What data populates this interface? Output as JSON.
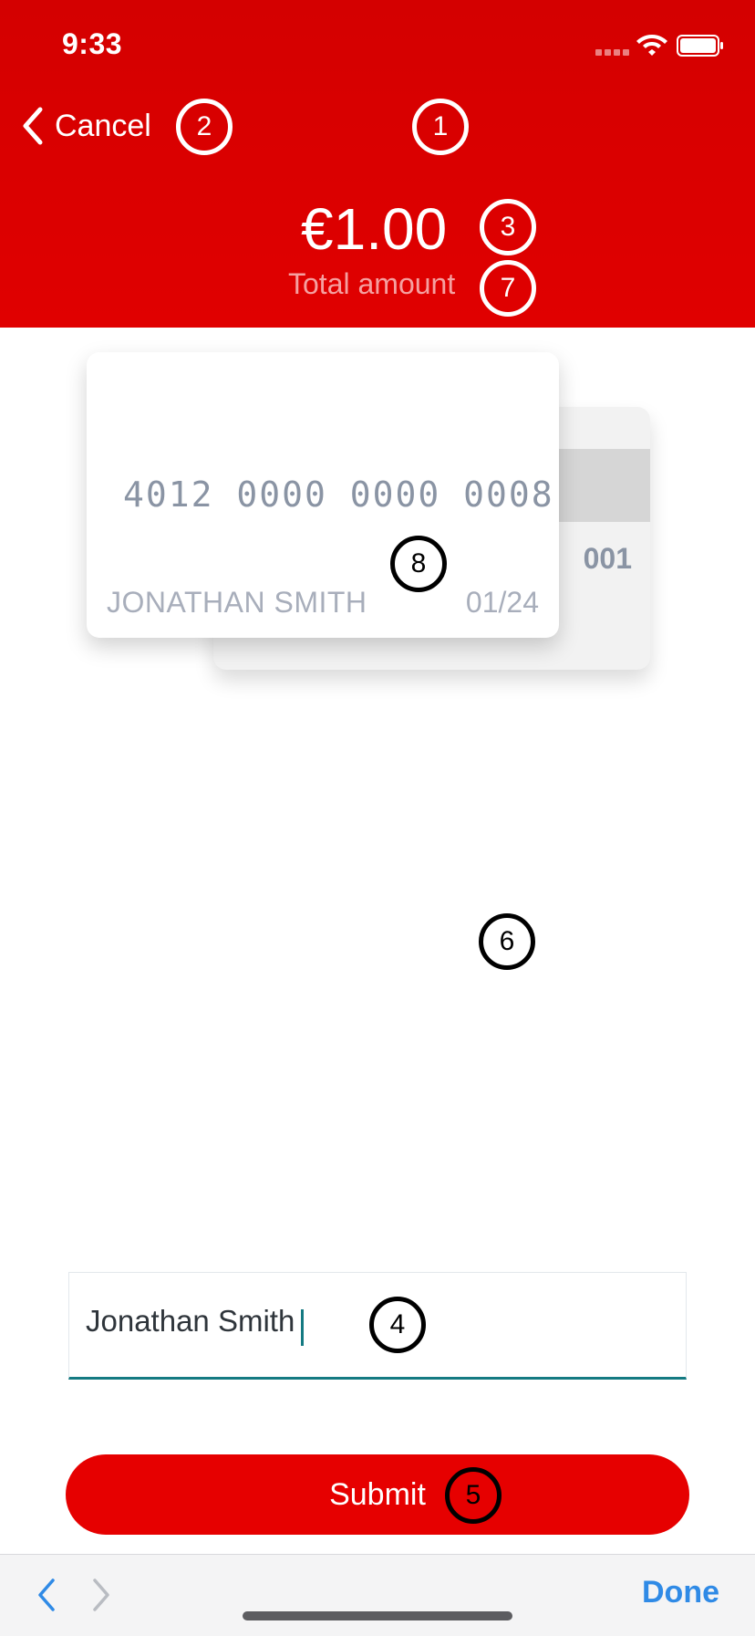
{
  "status_bar": {
    "time": "9:33"
  },
  "header": {
    "back_label": "Cancel",
    "amount": "€1.00",
    "amount_label": "Total amount"
  },
  "card": {
    "number": "4012 0000 0000 0008",
    "holder": "JONATHAN SMITH",
    "expiry": "01/24",
    "cvv": "001"
  },
  "form": {
    "name_value": "Jonathan Smith"
  },
  "actions": {
    "submit_label": "Submit"
  },
  "keyboard_toolbar": {
    "done_label": "Done"
  },
  "annotations": {
    "b1": "1",
    "b2": "2",
    "b3": "3",
    "b4": "4",
    "b5": "5",
    "b6": "6",
    "b7": "7",
    "b8": "8"
  },
  "colors": {
    "header_red": "#e00000",
    "submit_red": "#e60000",
    "input_accent": "#147a82",
    "toolbar_blue": "#2f8ae6"
  },
  "icons": {
    "back": "chevron-left-icon",
    "wifi": "wifi-icon",
    "battery": "battery-icon",
    "signal": "signal-dots-icon",
    "toolbar_prev": "chevron-left-icon",
    "toolbar_next": "chevron-right-icon"
  }
}
